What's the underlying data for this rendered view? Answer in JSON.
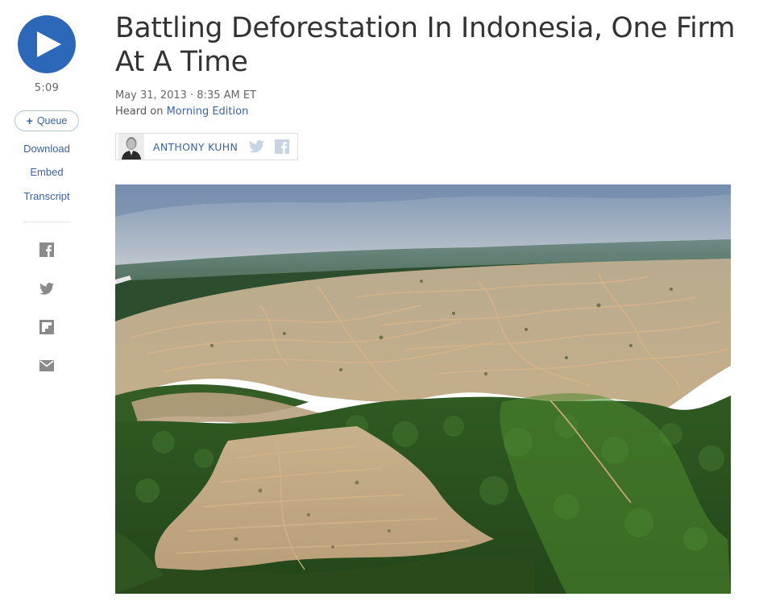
{
  "player": {
    "duration": "5:09",
    "queue_label": "Queue",
    "queue_icon": "plus-icon",
    "links": {
      "download": "Download",
      "embed": "Embed",
      "transcript": "Transcript"
    },
    "share_icons": [
      "facebook-icon",
      "twitter-icon",
      "flipboard-icon",
      "email-icon"
    ],
    "accent_color": "#2d68b8"
  },
  "article": {
    "title": "Battling Deforestation In Indonesia, One Firm At A Time",
    "date": "May 31, 2013 · 8:35 AM ET",
    "heard_on_prefix": "Heard on",
    "program": "Morning Edition",
    "byline": {
      "author": "ANTHONY KUHN",
      "social_icons": [
        "twitter-icon",
        "facebook-icon"
      ]
    }
  },
  "colors": {
    "link": "#3a63a8",
    "text": "#333333",
    "muted": "#666666"
  }
}
